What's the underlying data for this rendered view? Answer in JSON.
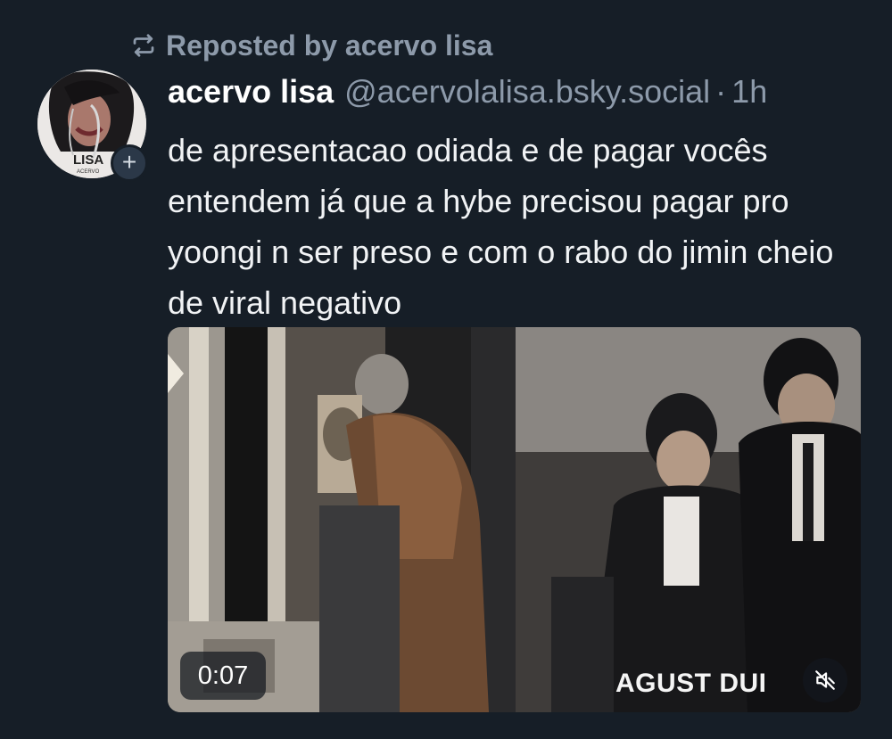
{
  "repost": {
    "label": "Reposted by acervo lisa",
    "icon": "repost-icon"
  },
  "post": {
    "avatar_text": "LISA",
    "avatar_subtext": "ACERVO",
    "follow_symbol": "+",
    "display_name": "acervo lisa",
    "handle": "@acervolalisa.bsky.social",
    "separator": "·",
    "time": "1h",
    "text": "de apresentacao odiada e de pagar vocês entendem já que a hybe precisou pagar pro yoongi n ser preso e com o rabo do jimin cheio de viral negativo"
  },
  "video": {
    "duration": "0:07",
    "caption": "AGUST DUI",
    "mute_icon": "speaker-muted-icon"
  },
  "colors": {
    "background": "#161e27",
    "text": "#f1f3f5",
    "muted": "#8d9aaa"
  }
}
